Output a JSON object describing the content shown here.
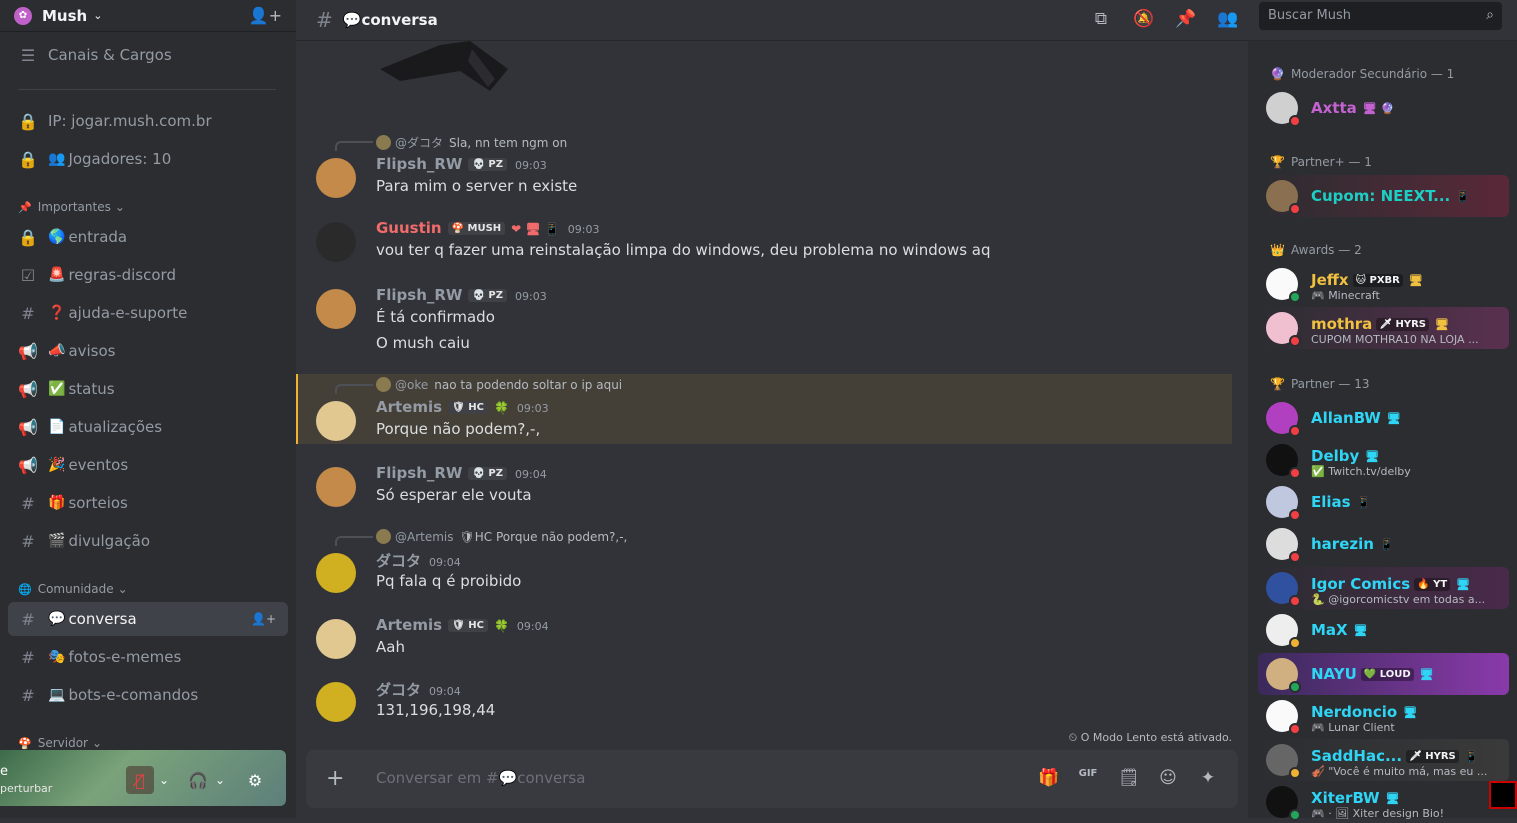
{
  "server": {
    "name": "Mush",
    "logo": "✿"
  },
  "sidebar": {
    "items": [
      {
        "icon": "☰",
        "emoji": "",
        "label": "Canais & Cargos"
      },
      {
        "icon": "🔒",
        "emoji": "",
        "label": "IP: jogar.mush.com.br"
      },
      {
        "icon": "🔒",
        "emoji": "👥",
        "label": "Jogadores: 10"
      }
    ],
    "categories": {
      "importantes": "Importantes",
      "comunidade": "Comunidade",
      "servidor": "Servidor"
    },
    "channels_importantes": [
      {
        "icon": "🔒",
        "emoji": "🌎",
        "label": "entrada"
      },
      {
        "icon": "☑",
        "emoji": "🚨",
        "label": "regras-discord"
      },
      {
        "icon": "#",
        "emoji": "❓",
        "label": "ajuda-e-suporte"
      },
      {
        "icon": "📢",
        "emoji": "📣",
        "label": "avisos"
      },
      {
        "icon": "📢",
        "emoji": "✅",
        "label": "status"
      },
      {
        "icon": "📢",
        "emoji": "📄",
        "label": "atualizações"
      },
      {
        "icon": "📢",
        "emoji": "🎉",
        "label": "eventos"
      },
      {
        "icon": "#",
        "emoji": "🎁",
        "label": "sorteios"
      },
      {
        "icon": "#",
        "emoji": "🎬",
        "label": "divulgação"
      }
    ],
    "channels_comunidade": [
      {
        "icon": "#",
        "emoji": "💬",
        "label": "conversa",
        "selected": true
      },
      {
        "icon": "#",
        "emoji": "🎭",
        "label": "fotos-e-memes"
      },
      {
        "icon": "#",
        "emoji": "💻",
        "label": "bots-e-comandos"
      }
    ]
  },
  "userbar": {
    "name": "e",
    "status": "perturbar"
  },
  "topbar": {
    "channel_emoji": "💬",
    "channel": "conversa",
    "search_placeholder": "Buscar Mush"
  },
  "messages": [
    {
      "reply": {
        "name": "@ダコタ",
        "text": "Sla, nn tem ngm on"
      },
      "author": "Flipsh_RW",
      "author_color": "#949ba4",
      "badge": "💀 PZ",
      "time": "09:03",
      "lines": [
        "Para mim o server n existe"
      ]
    },
    {
      "author": "Guustin",
      "author_color": "#f26b6b",
      "badge": "🍄 MUSH",
      "extra": "❤ 🖥 📱",
      "time": "09:03",
      "lines": [
        "vou ter q fazer uma reinstalação limpa do windows, deu problema no windows aq"
      ]
    },
    {
      "author": "Flipsh_RW",
      "author_color": "#949ba4",
      "badge": "💀 PZ",
      "time": "09:03",
      "lines": [
        "É tá confirmado",
        "O mush caiu"
      ]
    },
    {
      "reply": {
        "name": "@oke",
        "text": "nao ta podendo soltar o ip aqui"
      },
      "author": "Artemis",
      "author_color": "#949ba4",
      "badge": "🛡 HC",
      "extra": "🍀",
      "time": "09:03",
      "lines": [
        "Porque não podem?,-,"
      ],
      "highlight": true
    },
    {
      "author": "Flipsh_RW",
      "author_color": "#949ba4",
      "badge": "💀 PZ",
      "time": "09:04",
      "lines": [
        "Só esperar ele vouta"
      ]
    },
    {
      "reply": {
        "name": "@Artemis",
        "text": "🛡HC  Porque não podem?,-,"
      },
      "author": "ダコタ",
      "author_color": "#949ba4",
      "time": "09:04",
      "lines": [
        "Pq fala q é proibido"
      ]
    },
    {
      "author": "Artemis",
      "author_color": "#949ba4",
      "badge": "🛡 HC",
      "extra": "🍀",
      "time": "09:04",
      "lines": [
        "Aah"
      ]
    },
    {
      "author": "ダコタ",
      "author_color": "#949ba4",
      "time": "09:04",
      "lines": [
        "131,196,198,44"
      ]
    }
  ],
  "slow_mode": "O Modo Lento está ativado.",
  "composer": {
    "placeholder": "Conversar em #💬conversa"
  },
  "member_groups": [
    {
      "label": "Moderador Secundário — 1",
      "icon": "🔮"
    },
    {
      "label": "Partner+ — 1",
      "icon": "🏆"
    },
    {
      "label": "Awards — 2",
      "icon": "👑"
    },
    {
      "label": "Partner — 13",
      "icon": "🏆"
    }
  ],
  "members": [
    {
      "name": "Axtta",
      "color": "#c462d1",
      "tag": "",
      "activity": "",
      "icons": "🖥 🔮"
    },
    {
      "name": "Cupom: NEEXT...",
      "color": "#1ccfc4",
      "tag": "",
      "activity": "",
      "icons": "📱"
    },
    {
      "name": "Jeffx",
      "color": "#f0c040",
      "tag": "🐱 PXBR",
      "activity": "🎮 Minecraft",
      "icons": "🖥"
    },
    {
      "name": "mothra",
      "color": "#f0c040",
      "tag": "🗡 HYRS",
      "activity": "CUPOM MOTHRA10 NA LOJA ...",
      "icons": "🖥"
    },
    {
      "name": "AllanBW",
      "color": "#2fd5f5",
      "tag": "",
      "activity": "",
      "icons": "🖥"
    },
    {
      "name": "Delby",
      "color": "#2fd5f5",
      "tag": "",
      "activity": "✅ Twitch.tv/delby",
      "icons": "🖥"
    },
    {
      "name": "Elias",
      "color": "#2fd5f5",
      "tag": "",
      "activity": "",
      "icons": "📱"
    },
    {
      "name": "harezin",
      "color": "#2fd5f5",
      "tag": "",
      "activity": "",
      "icons": "📱"
    },
    {
      "name": "Igor Comics",
      "color": "#2fd5f5",
      "tag": "🔥 YT",
      "activity": "🐍 @igorcomicstv em todas a...",
      "icons": "🖥"
    },
    {
      "name": "MaX",
      "color": "#2fd5f5",
      "tag": "",
      "activity": "",
      "icons": "🖥"
    },
    {
      "name": "NAYU",
      "color": "#2fd5f5",
      "tag": "💚 LOUD",
      "activity": "",
      "icons": "🖥"
    },
    {
      "name": "Nerdoncio",
      "color": "#2fd5f5",
      "tag": "",
      "activity": "🎮 Lunar Client",
      "icons": "🖥"
    },
    {
      "name": "SaddHac...",
      "color": "#2fd5f5",
      "tag": "🗡 HYRS",
      "activity": "🎻 \"Você é muito má, mas eu ...",
      "icons": "📱"
    },
    {
      "name": "XiterBW",
      "color": "#2fd5f5",
      "tag": "",
      "activity": "🎮 · 🖼 Xiter design Bio!",
      "icons": "🖥"
    }
  ]
}
